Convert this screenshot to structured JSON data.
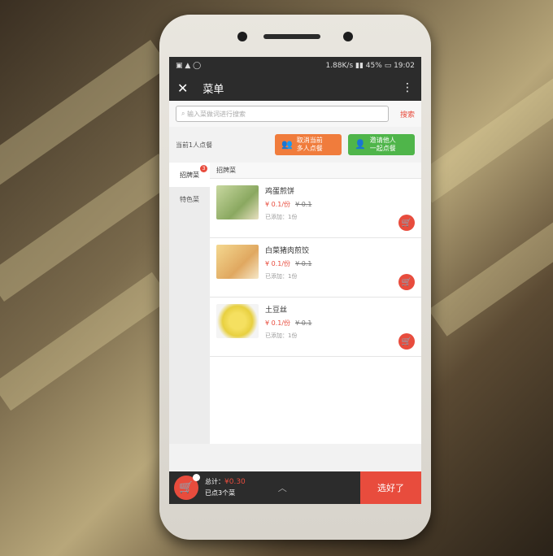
{
  "status": {
    "net_speed": "1.88K/s",
    "battery": "45%",
    "time": "19:02"
  },
  "header": {
    "title": "菜单"
  },
  "search": {
    "placeholder": "输入菜做词进行搜索",
    "button": "搜索"
  },
  "order": {
    "label": "当前1人点餐",
    "multi_btn": "取消当前\n多人点餐",
    "invite_btn": "邀请他人\n一起点餐"
  },
  "categories": [
    {
      "label": "招牌菜",
      "badge": "3"
    },
    {
      "label": "特色菜"
    }
  ],
  "section": {
    "title": "招牌菜"
  },
  "items": [
    {
      "name": "鸡蛋煎饼",
      "price": "¥ 0.1/份",
      "old_price": "¥ 0.1",
      "added": "已添加：1份"
    },
    {
      "name": "白菜猪肉煎饺",
      "price": "¥ 0.1/份",
      "old_price": "¥ 0.1",
      "added": "已添加：1份"
    },
    {
      "name": "土豆丝",
      "price": "¥ 0.1/份",
      "old_price": "¥ 0.1",
      "added": "已添加：1份"
    }
  ],
  "footer": {
    "total_label": "总计：",
    "total_amount": "¥0.30",
    "count": "已点3个菜",
    "done": "选好了"
  }
}
